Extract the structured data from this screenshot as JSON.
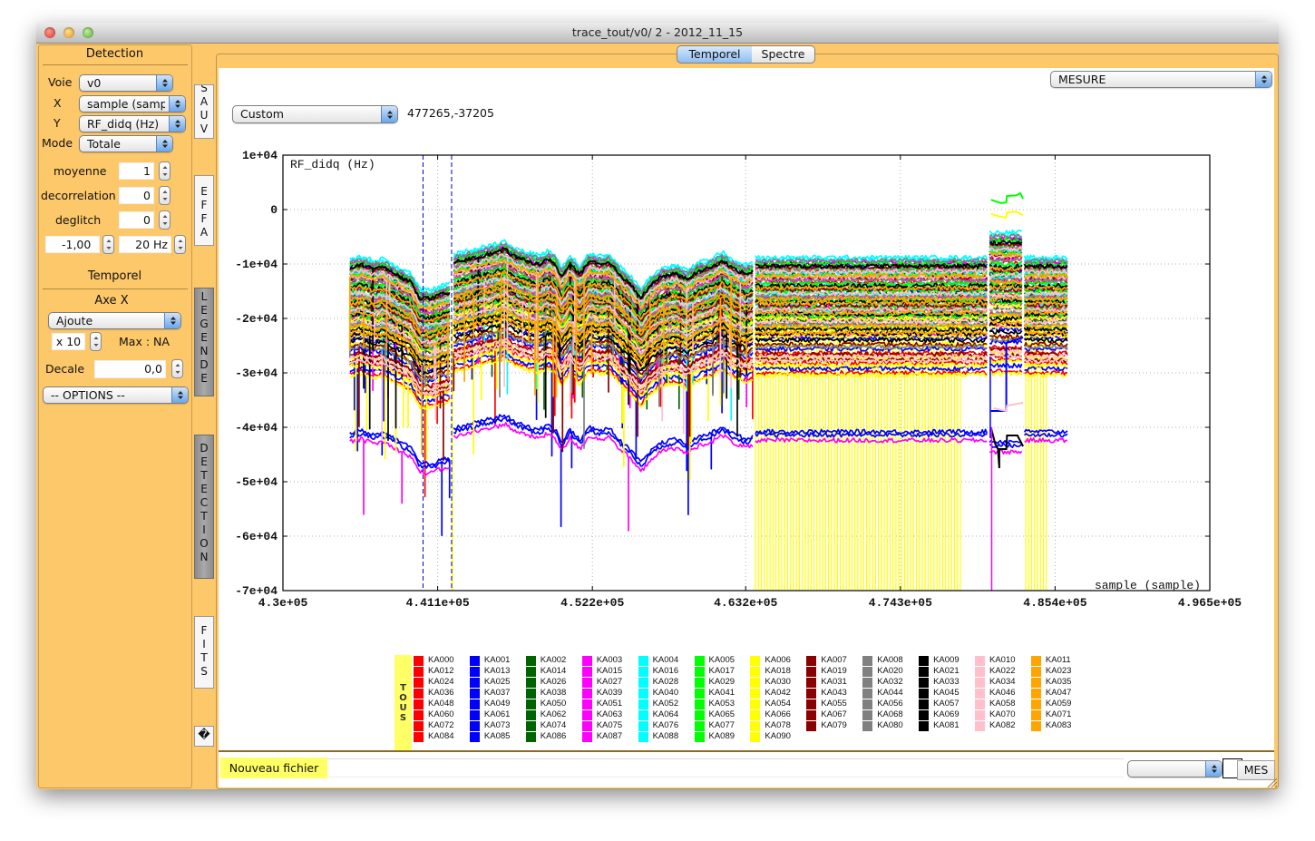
{
  "window": {
    "title": "trace_tout/v0/ 2 - 2012_11_15"
  },
  "tabs": [
    {
      "label": "Temporel",
      "selected": true
    },
    {
      "label": "Spectre",
      "selected": false
    }
  ],
  "left_panel": {
    "detection_title": "Detection",
    "voie": {
      "label": "Voie",
      "value": "v0"
    },
    "x": {
      "label": "X",
      "value": "sample (sample)"
    },
    "y": {
      "label": "Y",
      "value": "RF_didq (Hz)"
    },
    "mode": {
      "label": "Mode",
      "value": "Totale"
    },
    "moyenne": {
      "label": "moyenne",
      "value": "1"
    },
    "decorrelation": {
      "label": "decorrelation",
      "value": "0"
    },
    "deglitch": {
      "label": "deglitch",
      "value": "0"
    },
    "threshold_value": "-1,00",
    "frequency_value": "20 Hz",
    "temporel_title": "Temporel",
    "axe_x_title": "Axe X",
    "axe_x_mode": "Ajoute",
    "multiplier": "x 10",
    "max_text": "Max : NA",
    "decale": {
      "label": "Decale",
      "value": "0,0"
    },
    "options": "-- OPTIONS --"
  },
  "side_tabs": [
    {
      "label": "SAUV",
      "active": false
    },
    {
      "label": "EFFA",
      "active": false
    },
    {
      "label": "LEGENDE",
      "active": true
    },
    {
      "label": "DETECTION",
      "active": true
    },
    {
      "label": "FITS",
      "active": false
    },
    {
      "label": "�",
      "active": false
    }
  ],
  "main": {
    "mesure_select": "MESURE",
    "preset_select": "Custom",
    "cursor_readout": "477265,-37205"
  },
  "legend": {
    "all_label": "TOUS"
  },
  "bottom": {
    "new_file_label": "Nouveau fichier",
    "filename_value": "",
    "select_value": "",
    "mes_button": "MES"
  },
  "chart_data": {
    "type": "line",
    "title": "",
    "ylabel": "RF_didq (Hz)",
    "xlabel": "sample (sample)",
    "xlim": [
      430000,
      496500
    ],
    "ylim": [
      -70000,
      10000
    ],
    "grid": true,
    "legend_position": "bottom",
    "xticks": [
      {
        "value": 430000,
        "label": "4.3e+05"
      },
      {
        "value": 441100,
        "label": "4.411e+05"
      },
      {
        "value": 452200,
        "label": "4.522e+05"
      },
      {
        "value": 463200,
        "label": "4.632e+05"
      },
      {
        "value": 474300,
        "label": "4.743e+05"
      },
      {
        "value": 485400,
        "label": "4.854e+05"
      },
      {
        "value": 496500,
        "label": "4.965e+05"
      }
    ],
    "yticks": [
      {
        "value": 10000,
        "label": "1e+04"
      },
      {
        "value": 0,
        "label": "0"
      },
      {
        "value": -10000,
        "label": "-1e+04"
      },
      {
        "value": -20000,
        "label": "-2e+04"
      },
      {
        "value": -30000,
        "label": "-3e+04"
      },
      {
        "value": -40000,
        "label": "-4e+04"
      },
      {
        "value": -50000,
        "label": "-5e+04"
      },
      {
        "value": -60000,
        "label": "-6e+04"
      },
      {
        "value": -70000,
        "label": "-7e+04"
      }
    ],
    "envelope": [
      [
        434800,
        -9000
      ],
      [
        435600,
        -8600
      ],
      [
        436600,
        -9400
      ],
      [
        437200,
        -9000
      ],
      [
        438000,
        -10200
      ],
      [
        438600,
        -11000
      ],
      [
        439200,
        -11800
      ],
      [
        439800,
        -14600
      ],
      [
        440600,
        -14800
      ],
      [
        441400,
        -14000
      ],
      [
        442050,
        -13600
      ],
      [
        442250,
        -8200
      ],
      [
        443200,
        -7600
      ],
      [
        444400,
        -6800
      ],
      [
        445400,
        -6200
      ],
      [
        445900,
        -5700
      ],
      [
        446600,
        -7000
      ],
      [
        447400,
        -7800
      ],
      [
        448400,
        -8400
      ],
      [
        449000,
        -7600
      ],
      [
        449500,
        -8200
      ],
      [
        450000,
        -10800
      ],
      [
        450600,
        -8400
      ],
      [
        451300,
        -10400
      ],
      [
        452000,
        -8000
      ],
      [
        452800,
        -8600
      ],
      [
        453400,
        -8200
      ],
      [
        454200,
        -10400
      ],
      [
        455000,
        -12400
      ],
      [
        455700,
        -14600
      ],
      [
        456400,
        -12200
      ],
      [
        457200,
        -10800
      ],
      [
        458200,
        -10200
      ],
      [
        459000,
        -11200
      ],
      [
        459800,
        -9800
      ],
      [
        460800,
        -9000
      ],
      [
        461500,
        -7800
      ],
      [
        462300,
        -9200
      ],
      [
        463200,
        -10200
      ],
      [
        463800,
        -9600
      ],
      [
        463900,
        -8800
      ],
      [
        480600,
        -8800
      ],
      [
        480700,
        -4200
      ],
      [
        483100,
        -4200
      ],
      [
        483200,
        -8800
      ],
      [
        486300,
        -8800
      ]
    ],
    "segments": [
      {
        "from": 434800,
        "to": 442050,
        "spikes": true,
        "offset_scale": 1.0
      },
      {
        "from": 442250,
        "to": 463800,
        "spikes": true,
        "offset_scale": 1.0
      },
      {
        "from": 463900,
        "to": 480600,
        "spikes": false,
        "offset_scale": 1.0
      },
      {
        "from": 480700,
        "to": 483100,
        "spikes": false,
        "offset_scale": 1.2
      },
      {
        "from": 483200,
        "to": 486300,
        "spikes": false,
        "offset_scale": 1.0
      }
    ],
    "series": [
      {
        "color": "#ff0000",
        "names": [
          "KA000",
          "KA012",
          "KA024",
          "KA036",
          "KA048",
          "KA060",
          "KA072",
          "KA084"
        ],
        "offsets": [
          -2600,
          -4600,
          -7200,
          -9600,
          -12400,
          -17600,
          -19400,
          -21200
        ]
      },
      {
        "color": "#0000ff",
        "names": [
          "KA001",
          "KA013",
          "KA025",
          "KA037",
          "KA049",
          "KA061",
          "KA073",
          "KA085"
        ],
        "offsets": [
          -1500,
          -3600,
          -6000,
          -14800,
          -16800,
          -20400,
          -32000,
          -32600
        ]
      },
      {
        "color": "#006400",
        "names": [
          "KA002",
          "KA014",
          "KA026",
          "KA038",
          "KA050",
          "KA062",
          "KA074",
          "KA086"
        ],
        "offsets": [
          -3000,
          -5400,
          -8000,
          -10600,
          -13000,
          -1000,
          -6600,
          -11600
        ]
      },
      {
        "color": "#ff00ff",
        "names": [
          "KA003",
          "KA015",
          "KA027",
          "KA039",
          "KA051",
          "KA063",
          "KA075",
          "KA087"
        ],
        "offsets": [
          -800,
          -2000,
          -4000,
          -7400,
          -9000,
          -11000,
          -14200,
          -33600
        ]
      },
      {
        "color": "#00ffff",
        "names": [
          "KA004",
          "KA016",
          "KA028",
          "KA040",
          "KA052",
          "KA064",
          "KA076",
          "KA088"
        ],
        "offsets": [
          0,
          -2800,
          -5000,
          -8600,
          -10200,
          -12600,
          -400,
          -6800
        ]
      },
      {
        "color": "#00ff00",
        "names": [
          "KA005",
          "KA017",
          "KA029",
          "KA041",
          "KA053",
          "KA065",
          "KA077",
          "KA089"
        ],
        "offsets": [
          -1200,
          -3200,
          -4800,
          -6200,
          -7800,
          -9200,
          -10800,
          -2200
        ]
      },
      {
        "color": "#ffff00",
        "names": [
          "KA006",
          "KA018",
          "KA030",
          "KA042",
          "KA054",
          "KA066",
          "KA078",
          "KA090"
        ],
        "offsets": [
          -11200,
          -12800,
          -14400,
          -16000,
          -18400,
          -19800,
          -21600,
          -13600
        ]
      },
      {
        "color": "#8b0000",
        "names": [
          "KA007",
          "KA019",
          "KA031",
          "KA043",
          "KA055",
          "KA067",
          "KA079"
        ],
        "offsets": [
          -16000,
          -17800,
          -18800,
          -5800,
          -8800,
          -3800,
          -1800
        ]
      },
      {
        "color": "#808080",
        "names": [
          "KA008",
          "KA020",
          "KA032",
          "KA044",
          "KA056",
          "KA068",
          "KA080"
        ],
        "offsets": [
          -600,
          -2400,
          -16400,
          -4200,
          -7200,
          -9800,
          -12200
        ]
      },
      {
        "color": "#000000",
        "names": [
          "KA009",
          "KA021",
          "KA033",
          "KA045",
          "KA057",
          "KA069",
          "KA081"
        ],
        "offsets": [
          -15200,
          -1600,
          -5200,
          -8200,
          -10400,
          -13200,
          -14000
        ]
      },
      {
        "color": "#ffc0cb",
        "names": [
          "KA010",
          "KA022",
          "KA034",
          "KA046",
          "KA058",
          "KA070",
          "KA082"
        ],
        "offsets": [
          -19000,
          -18200,
          -2600,
          -6600,
          -11800,
          -3600,
          -9600
        ]
      },
      {
        "color": "#ffa500",
        "names": [
          "KA011",
          "KA023",
          "KA035",
          "KA047",
          "KA059",
          "KA071",
          "KA083"
        ],
        "offsets": [
          -3400,
          -5600,
          -7600,
          -10200,
          -12600,
          -13800,
          -8400
        ]
      }
    ],
    "special_traces": [
      {
        "color": "#00ff00",
        "points": [
          [
            480800,
            1800
          ],
          [
            481500,
            1200
          ],
          [
            481900,
            1300
          ],
          [
            481950,
            2500
          ],
          [
            482600,
            2600
          ],
          [
            482900,
            3000
          ],
          [
            483100,
            2000
          ]
        ]
      },
      {
        "color": "#ffff00",
        "points": [
          [
            480800,
            -800
          ],
          [
            481300,
            -1200
          ],
          [
            481900,
            -1500
          ],
          [
            481950,
            -500
          ],
          [
            482600,
            -400
          ],
          [
            483100,
            -1000
          ]
        ]
      },
      {
        "color": "#0000ff",
        "points": [
          [
            480800,
            -37000
          ],
          [
            481900,
            -37000
          ],
          [
            481900,
            -24500
          ],
          [
            483100,
            -23500
          ]
        ]
      },
      {
        "color": "#ffc0cb",
        "points": [
          [
            481000,
            -36500
          ],
          [
            481900,
            -37000
          ],
          [
            481950,
            -36000
          ],
          [
            483100,
            -35500
          ]
        ]
      },
      {
        "color": "#000000",
        "points": [
          [
            480800,
            -40000
          ],
          [
            481100,
            -43000
          ],
          [
            481300,
            -44000
          ],
          [
            481400,
            -47500
          ],
          [
            481400,
            -44000
          ],
          [
            481900,
            -44000
          ],
          [
            481950,
            -41500
          ],
          [
            482700,
            -41500
          ],
          [
            483100,
            -43500
          ]
        ]
      }
    ],
    "vertical_bursts": [
      {
        "color": "#ffff00",
        "from": 463900,
        "to": 478700,
        "step": 210,
        "y_top": -17000,
        "y_bottom": -70000
      },
      {
        "color": "#ffff00",
        "from": 483300,
        "to": 484900,
        "step": 210,
        "y_top": -17000,
        "y_bottom": -70000
      }
    ],
    "vertical_lines": [
      {
        "color": "#ffff00",
        "x": 442150,
        "y_top": -20000,
        "y_bottom": -70000
      },
      {
        "color": "#ff00ff",
        "x": 480850,
        "y_top": -40000,
        "y_bottom": -70000
      },
      {
        "color": "#0000ff",
        "x": 480750,
        "y_top": -27000,
        "y_bottom": -42000
      }
    ],
    "cursors": [
      440050,
      442100
    ]
  }
}
